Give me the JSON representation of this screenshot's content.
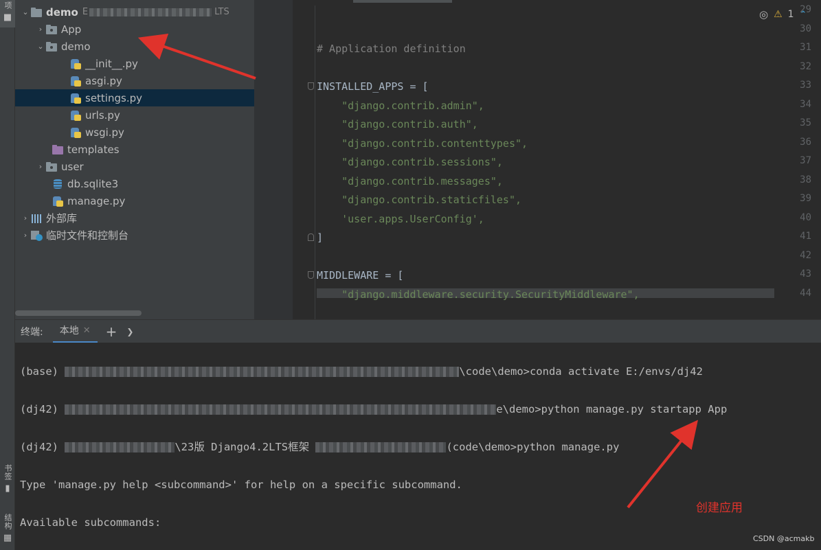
{
  "left_strip": {
    "project_label": "项",
    "bookmarks_label": "书签",
    "structure_label": "结构"
  },
  "project_tree": [
    {
      "label": "demo",
      "path_suffix": "E",
      "path_tail": "LTS",
      "expanded": true,
      "type": "folder-root"
    },
    {
      "label": "App",
      "expanded": false,
      "type": "folder"
    },
    {
      "label": "demo",
      "expanded": true,
      "type": "folder"
    },
    {
      "label": "__init__.py",
      "type": "py"
    },
    {
      "label": "asgi.py",
      "type": "py"
    },
    {
      "label": "settings.py",
      "type": "py",
      "selected": true
    },
    {
      "label": "urls.py",
      "type": "py"
    },
    {
      "label": "wsgi.py",
      "type": "py"
    },
    {
      "label": "templates",
      "type": "folder-purple"
    },
    {
      "label": "user",
      "expanded": false,
      "type": "folder"
    },
    {
      "label": "db.sqlite3",
      "type": "db"
    },
    {
      "label": "manage.py",
      "type": "py"
    },
    {
      "label": "外部库",
      "expanded": false,
      "type": "lib"
    },
    {
      "label": "临时文件和控制台",
      "expanded": false,
      "type": "scratch"
    }
  ],
  "editor": {
    "line_numbers": [
      "29",
      "30",
      "31",
      "32",
      "33",
      "34",
      "35",
      "36",
      "37",
      "38",
      "39",
      "40",
      "41",
      "42",
      "43",
      "44"
    ],
    "lines": [
      "",
      "",
      "# Application definition",
      "",
      "INSTALLED_APPS = [",
      "    \"django.contrib.admin\",",
      "    \"django.contrib.auth\",",
      "    \"django.contrib.contenttypes\",",
      "    \"django.contrib.sessions\",",
      "    \"django.contrib.messages\",",
      "    \"django.contrib.staticfiles\",",
      "    'user.apps.UserConfig',",
      "]",
      "",
      "MIDDLEWARE = [",
      "    \"django.middleware.security.SecurityMiddleware\","
    ],
    "warning_count": "1"
  },
  "terminal": {
    "label": "终端:",
    "tab_local": "本地",
    "lines": [
      {
        "prefix": "(base) ",
        "middle_tail": "\\code\\demo>conda activate E:/envs/dj42"
      },
      {
        "prefix": "(dj42) ",
        "middle_tail": "e\\demo>python manage.py startapp App"
      },
      {
        "prefix": "(dj42) ",
        "middle_tail": "\\23版 Django4.2LTS框架 ",
        "end_tail": "(code\\demo>python manage.py"
      },
      {
        "prefix": "",
        "middle_tail": "Type 'manage.py help <subcommand>' for help on a specific subcommand."
      },
      {
        "prefix": "",
        "middle_tail": "Available subcommands:"
      }
    ]
  },
  "annotation": {
    "create_app": "创建应用",
    "arrow_color": "#e0332c"
  },
  "watermark": "CSDN @acmakb",
  "colors": {
    "editor_bg": "#2b2b2b",
    "panel_bg": "#3c3f41",
    "selection": "#0d293e",
    "string": "#6a8759",
    "comment": "#808080",
    "identifier": "#a9b7c6"
  }
}
